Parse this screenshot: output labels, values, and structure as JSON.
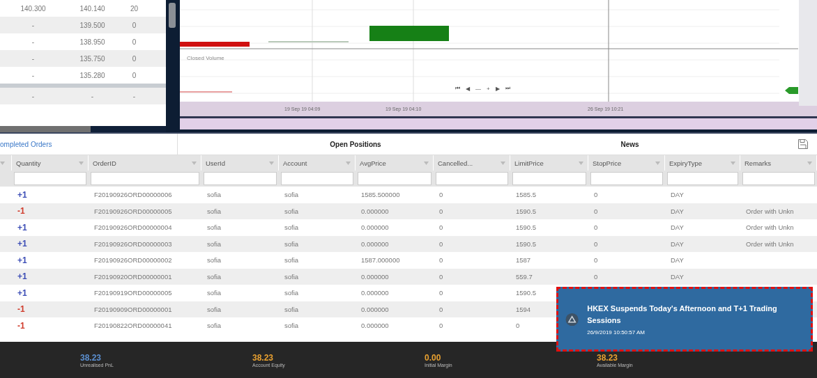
{
  "order_book": {
    "rows": [
      [
        "140.300",
        "140.140",
        "20"
      ],
      [
        "-",
        "139.500",
        "0"
      ],
      [
        "-",
        "138.950",
        "0"
      ],
      [
        "-",
        "135.750",
        "0"
      ],
      [
        "-",
        "135.280",
        "0"
      ],
      [
        "-",
        "-",
        "-"
      ]
    ]
  },
  "chart": {
    "legend": "Closed Volume",
    "controls": [
      "⏮",
      "◀",
      "—",
      "+",
      "▶",
      "⏭"
    ],
    "time_labels": [
      "19 Sep 19 04:09",
      "19 Sep 19 04:10",
      "26 Sep 19 10:21"
    ]
  },
  "tabs": [
    {
      "label": "ompleted Orders",
      "selected": true
    },
    {
      "label": "Open Positions",
      "selected": false
    },
    {
      "label": "News",
      "selected": false
    }
  ],
  "table": {
    "columns": [
      "Quantity",
      "OrderID",
      "UserId",
      "Account",
      "AvgPrice",
      "Cancelled...",
      "LimitPrice",
      "StopPrice",
      "ExpiryType",
      "Remarks"
    ],
    "rows": [
      {
        "color": "#3b4cb5",
        "cells": [
          "+1",
          "F20190926ORD00000006",
          "sofia",
          "sofia",
          "1585.500000",
          "0",
          "1585.5",
          "0",
          "DAY"
        ]
      },
      {
        "color": "#d03a2a",
        "cells": [
          "-1",
          "F20190926ORD00000005",
          "sofia",
          "sofia",
          "0.000000",
          "0",
          "1590.5",
          "0",
          "DAY",
          "Order with Unkn"
        ]
      },
      {
        "color": "#3b4cb5",
        "cells": [
          "+1",
          "F20190926ORD00000004",
          "sofia",
          "sofia",
          "0.000000",
          "0",
          "1590.5",
          "0",
          "DAY",
          "Order with Unkn"
        ]
      },
      {
        "color": "#3b4cb5",
        "cells": [
          "+1",
          "F20190926ORD00000003",
          "sofia",
          "sofia",
          "0.000000",
          "0",
          "1590.5",
          "0",
          "DAY",
          "Order with Unkn"
        ]
      },
      {
        "color": "#3b4cb5",
        "cells": [
          "+1",
          "F20190926ORD00000002",
          "sofia",
          "sofia",
          "1587.000000",
          "0",
          "1587",
          "0",
          "DAY"
        ]
      },
      {
        "color": "#3b4cb5",
        "cells": [
          "+1",
          "F20190920ORD00000001",
          "sofia",
          "sofia",
          "0.000000",
          "0",
          "559.7",
          "0",
          "DAY"
        ]
      },
      {
        "color": "#3b4cb5",
        "cells": [
          "+1",
          "F20190919ORD00000005",
          "sofia",
          "sofia",
          "0.000000",
          "0",
          "1590.5"
        ]
      },
      {
        "color": "#d03a2a",
        "cells": [
          "-1",
          "F20190909ORD00000001",
          "sofia",
          "sofia",
          "0.000000",
          "0",
          "1594"
        ]
      },
      {
        "color": "#d03a2a",
        "cells": [
          "-1",
          "F20190822ORD00000041",
          "sofia",
          "sofia",
          "0.000000",
          "0",
          "0"
        ]
      }
    ]
  },
  "notification": {
    "title": "HKEX Suspends Today's Afternoon and T+1 Trading Sessions",
    "time": "26/9/2019 10:50:57 AM"
  },
  "status_bar": [
    {
      "value": "38.23",
      "label": "Unrealised PnL",
      "color": "#5b8fd0"
    },
    {
      "value": "38.23",
      "label": "Account Equity",
      "color": "#e8a030"
    },
    {
      "value": "0.00",
      "label": "Initial Margin",
      "color": "#e8a030"
    },
    {
      "value": "38.23",
      "label": "Available Margin",
      "color": "#e8a030"
    }
  ]
}
